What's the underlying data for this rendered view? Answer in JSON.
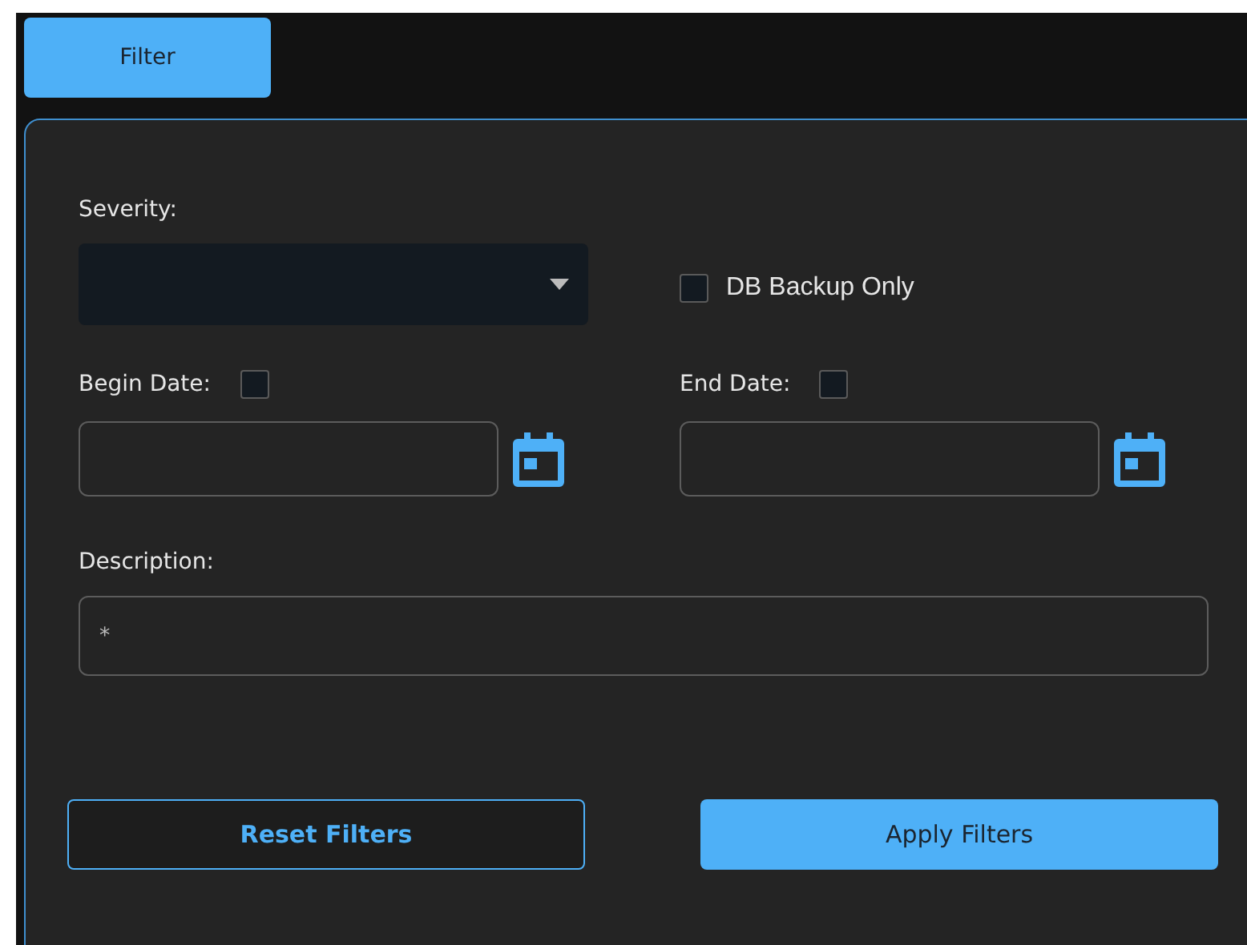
{
  "tabs": [
    {
      "label": "Filter",
      "selected": true
    }
  ],
  "severity": {
    "label": "Severity:"
  },
  "db_backup_only": {
    "label": "DB Backup Only",
    "checked": false
  },
  "begin_date": {
    "label": "Begin Date:",
    "checked": false
  },
  "end_date": {
    "label": "End Date:",
    "checked": false
  },
  "description": {
    "label": "Description:",
    "value": "*"
  },
  "buttons": [
    {
      "label": "Reset Filters",
      "kind": "outline"
    },
    {
      "label": "Apply Filters",
      "kind": "primary"
    }
  ]
}
